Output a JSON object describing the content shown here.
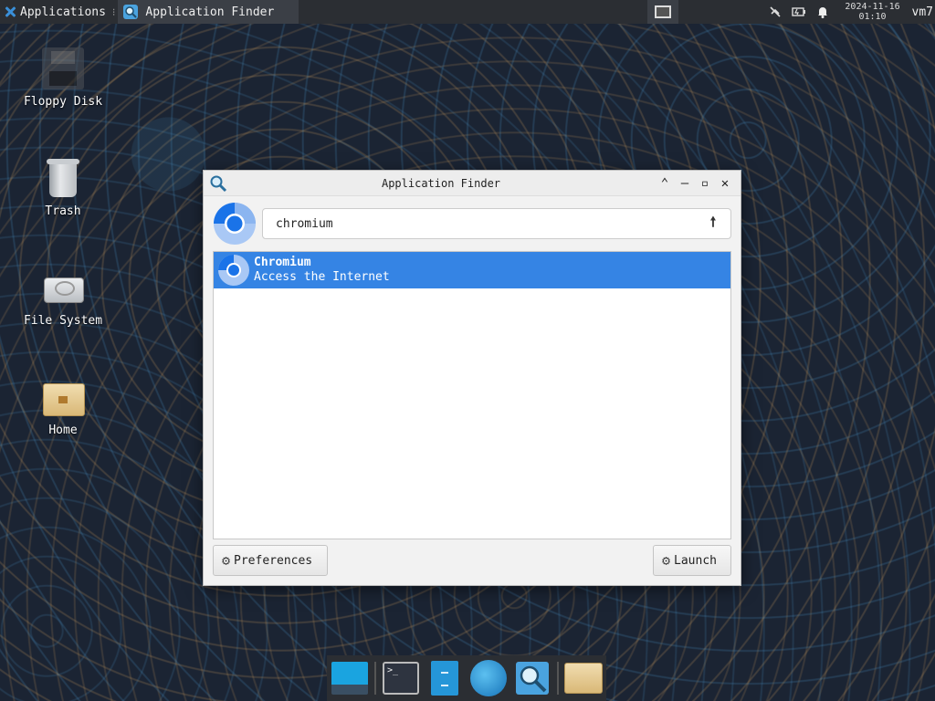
{
  "top_panel": {
    "applications_label": "Applications",
    "active_task_label": "Application Finder",
    "clock_date": "2024-11-16",
    "clock_time": "01:10",
    "user_label": "vm7"
  },
  "desktop_icons": {
    "floppy": "Floppy Disk",
    "trash": "Trash",
    "filesystem": "File System",
    "home": "Home"
  },
  "finder": {
    "title": "Application Finder",
    "search_value": "chromium",
    "results": [
      {
        "name": "Chromium",
        "description": "Access the Internet"
      }
    ],
    "preferences_label": "Preferences",
    "launch_label": "Launch"
  },
  "dock": {
    "items": [
      "show-desktop",
      "terminal",
      "file-manager",
      "web-browser",
      "app-finder",
      "folder"
    ]
  },
  "colors": {
    "selection": "#3584e4",
    "panel": "#2b2e33",
    "chromium_blue": "#1a73e8"
  }
}
